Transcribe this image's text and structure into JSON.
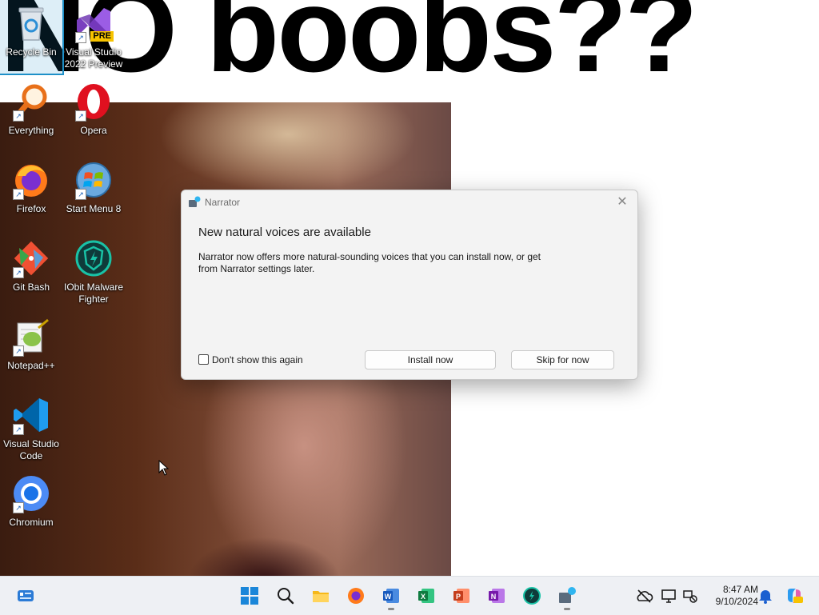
{
  "wallpaper": {
    "caption": "NO boobs??"
  },
  "desktop": {
    "icons": [
      {
        "label": "Recycle Bin",
        "icon": "recycle-bin-icon",
        "selected": true
      },
      {
        "label": "Visual Studio 2022 Preview",
        "icon": "visual-studio-preview-icon",
        "badge": "PRE"
      },
      {
        "label": "Everything",
        "icon": "everything-search-icon"
      },
      {
        "label": "Opera",
        "icon": "opera-icon"
      },
      {
        "label": "Firefox",
        "icon": "firefox-icon"
      },
      {
        "label": "Start Menu 8",
        "icon": "start-menu-8-icon"
      },
      {
        "label": "Git Bash",
        "icon": "git-bash-icon"
      },
      {
        "label": "IObit Malware Fighter",
        "icon": "iobit-malware-fighter-icon"
      },
      {
        "label": "Notepad++",
        "icon": "notepad-plus-plus-icon"
      },
      {
        "label": "Visual Studio Code",
        "icon": "vscode-icon"
      },
      {
        "label": "Chromium",
        "icon": "chromium-icon"
      }
    ]
  },
  "dialog": {
    "app_title": "Narrator",
    "close_glyph": "✕",
    "heading": "New natural voices are available",
    "body": "Narrator now offers more natural-sounding voices that you can install now, or get from Narrator settings later.",
    "checkbox_label": "Don't show this again",
    "checkbox_checked": false,
    "install_label": "Install now",
    "skip_label": "Skip for now"
  },
  "taskbar": {
    "items": [
      {
        "name": "widgets-icon",
        "running": false
      },
      {
        "name": "start-icon",
        "running": false
      },
      {
        "name": "search-icon",
        "running": false
      },
      {
        "name": "file-explorer-icon",
        "running": false
      },
      {
        "name": "firefox-icon",
        "running": false
      },
      {
        "name": "word-icon",
        "running": true
      },
      {
        "name": "excel-icon",
        "running": false
      },
      {
        "name": "powerpoint-icon",
        "running": false
      },
      {
        "name": "onenote-icon",
        "running": false
      },
      {
        "name": "iobit-icon",
        "running": false
      },
      {
        "name": "narrator-icon",
        "running": true
      }
    ],
    "tray": {
      "time": "8:47 AM",
      "date": "9/10/2024",
      "icons": [
        "onedrive-offline-icon",
        "display-icon",
        "network-icon",
        "notification-bell-icon",
        "copilot-icon"
      ]
    }
  },
  "colors": {
    "selection": "#1e90c8",
    "taskbar": "#eef0f4",
    "dialog_bg": "#f3f3f3"
  }
}
